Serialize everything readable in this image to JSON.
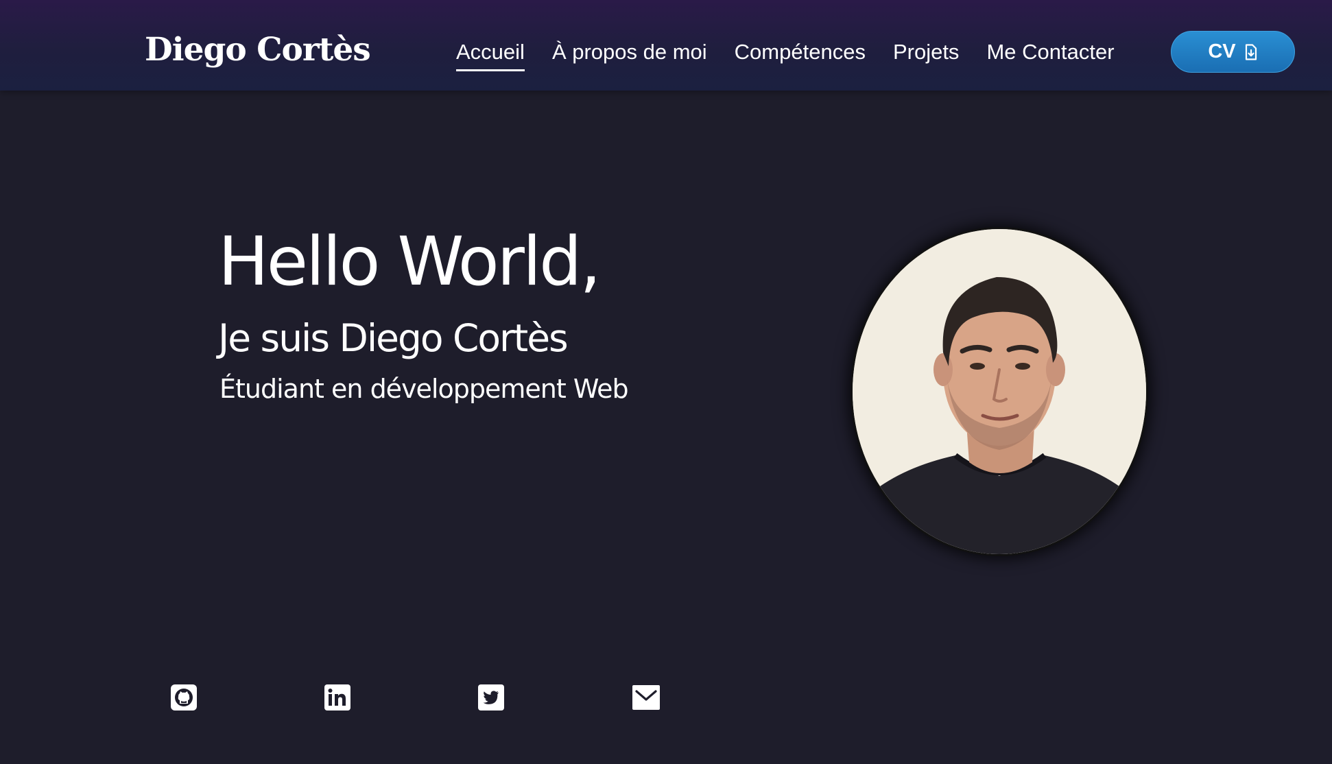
{
  "brand": {
    "name": "Diego Cortès"
  },
  "nav": {
    "items": [
      {
        "label": "Accueil",
        "active": true
      },
      {
        "label": "À propos de moi",
        "active": false
      },
      {
        "label": "Compétences",
        "active": false
      },
      {
        "label": "Projets",
        "active": false
      },
      {
        "label": "Me Contacter",
        "active": false
      }
    ],
    "cv_button": {
      "label": "CV",
      "icon": "file-download-icon",
      "color": "#1f7fc6"
    }
  },
  "hero": {
    "title": "Hello World,",
    "subtitle": "Je suis Diego Cortès",
    "role": "Étudiant en développement Web"
  },
  "photo": {
    "icon": "profile-photo"
  },
  "social": [
    {
      "icon": "github-icon"
    },
    {
      "icon": "linkedin-icon"
    },
    {
      "icon": "twitter-icon"
    },
    {
      "icon": "email-icon"
    }
  ],
  "colors": {
    "background": "#1e1d2b",
    "nav_gradient_top": "#2a1a48",
    "nav_gradient_bottom": "#1b2040",
    "accent": "#1f7fc6",
    "text": "#ffffff"
  }
}
